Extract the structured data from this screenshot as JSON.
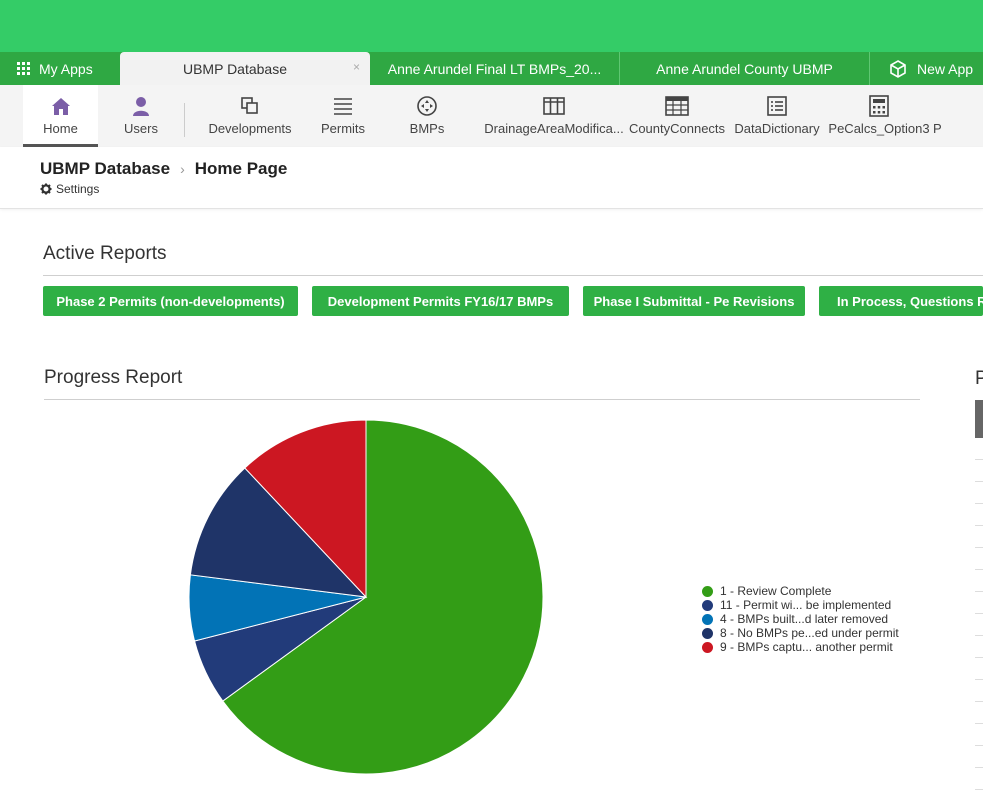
{
  "colors": {
    "topbar": "#34cc67",
    "tabsbar": "#2fa843",
    "button": "#2fb045",
    "pie_green": "#339d16",
    "pie_navy": "#223b7a",
    "pie_blue": "#0273b6",
    "pie_darknavy": "#1f3468",
    "pie_red": "#cc1722"
  },
  "tabs": {
    "my_apps": "My Apps",
    "active": "UBMP Database",
    "tab3": "Anne Arundel Final LT BMPs_20...",
    "tab4": "Anne Arundel County UBMP",
    "new_app": "New App",
    "close_symbol": "×"
  },
  "toolbar": {
    "items": [
      {
        "label": "Home",
        "icon": "home-icon"
      },
      {
        "label": "Users",
        "icon": "user-icon"
      },
      {
        "label": "Developments",
        "icon": "copy-icon"
      },
      {
        "label": "Permits",
        "icon": "list-icon"
      },
      {
        "label": "BMPs",
        "icon": "move-icon"
      },
      {
        "label": "DrainageAreaModifica...",
        "icon": "columns-icon"
      },
      {
        "label": "CountyConnects",
        "icon": "table-icon"
      },
      {
        "label": "DataDictionary",
        "icon": "list-box-icon"
      },
      {
        "label": "PeCalcs_Option3",
        "icon": "calculator-icon"
      },
      {
        "label": "P",
        "icon": ""
      }
    ]
  },
  "breadcrumb": {
    "app": "UBMP Database",
    "page": "Home Page",
    "settings": "Settings"
  },
  "active_reports": {
    "title": "Active Reports",
    "buttons": [
      "Phase 2 Permits (non-developments)",
      "Development Permits FY16/17 BMPs",
      "Phase I Submittal - Pe Revisions",
      "In Process, Questions Re"
    ]
  },
  "progress_report": {
    "title": "Progress Report"
  },
  "right_panel": {
    "title_fragment": "P"
  },
  "chart_data": {
    "type": "pie",
    "title": "",
    "series": [
      {
        "name": "1 - Review Complete",
        "value": 65,
        "color": "#339d16"
      },
      {
        "name": "11 - Permit wi... be implemented",
        "value": 6,
        "color": "#223b7a"
      },
      {
        "name": "4 - BMPs built...d later removed",
        "value": 6,
        "color": "#0273b6"
      },
      {
        "name": "8 - No BMPs pe...ed under permit",
        "value": 11,
        "color": "#1f3468"
      },
      {
        "name": "9 - BMPs captu... another permit",
        "value": 12,
        "color": "#cc1722"
      }
    ],
    "legend_position": "right"
  }
}
